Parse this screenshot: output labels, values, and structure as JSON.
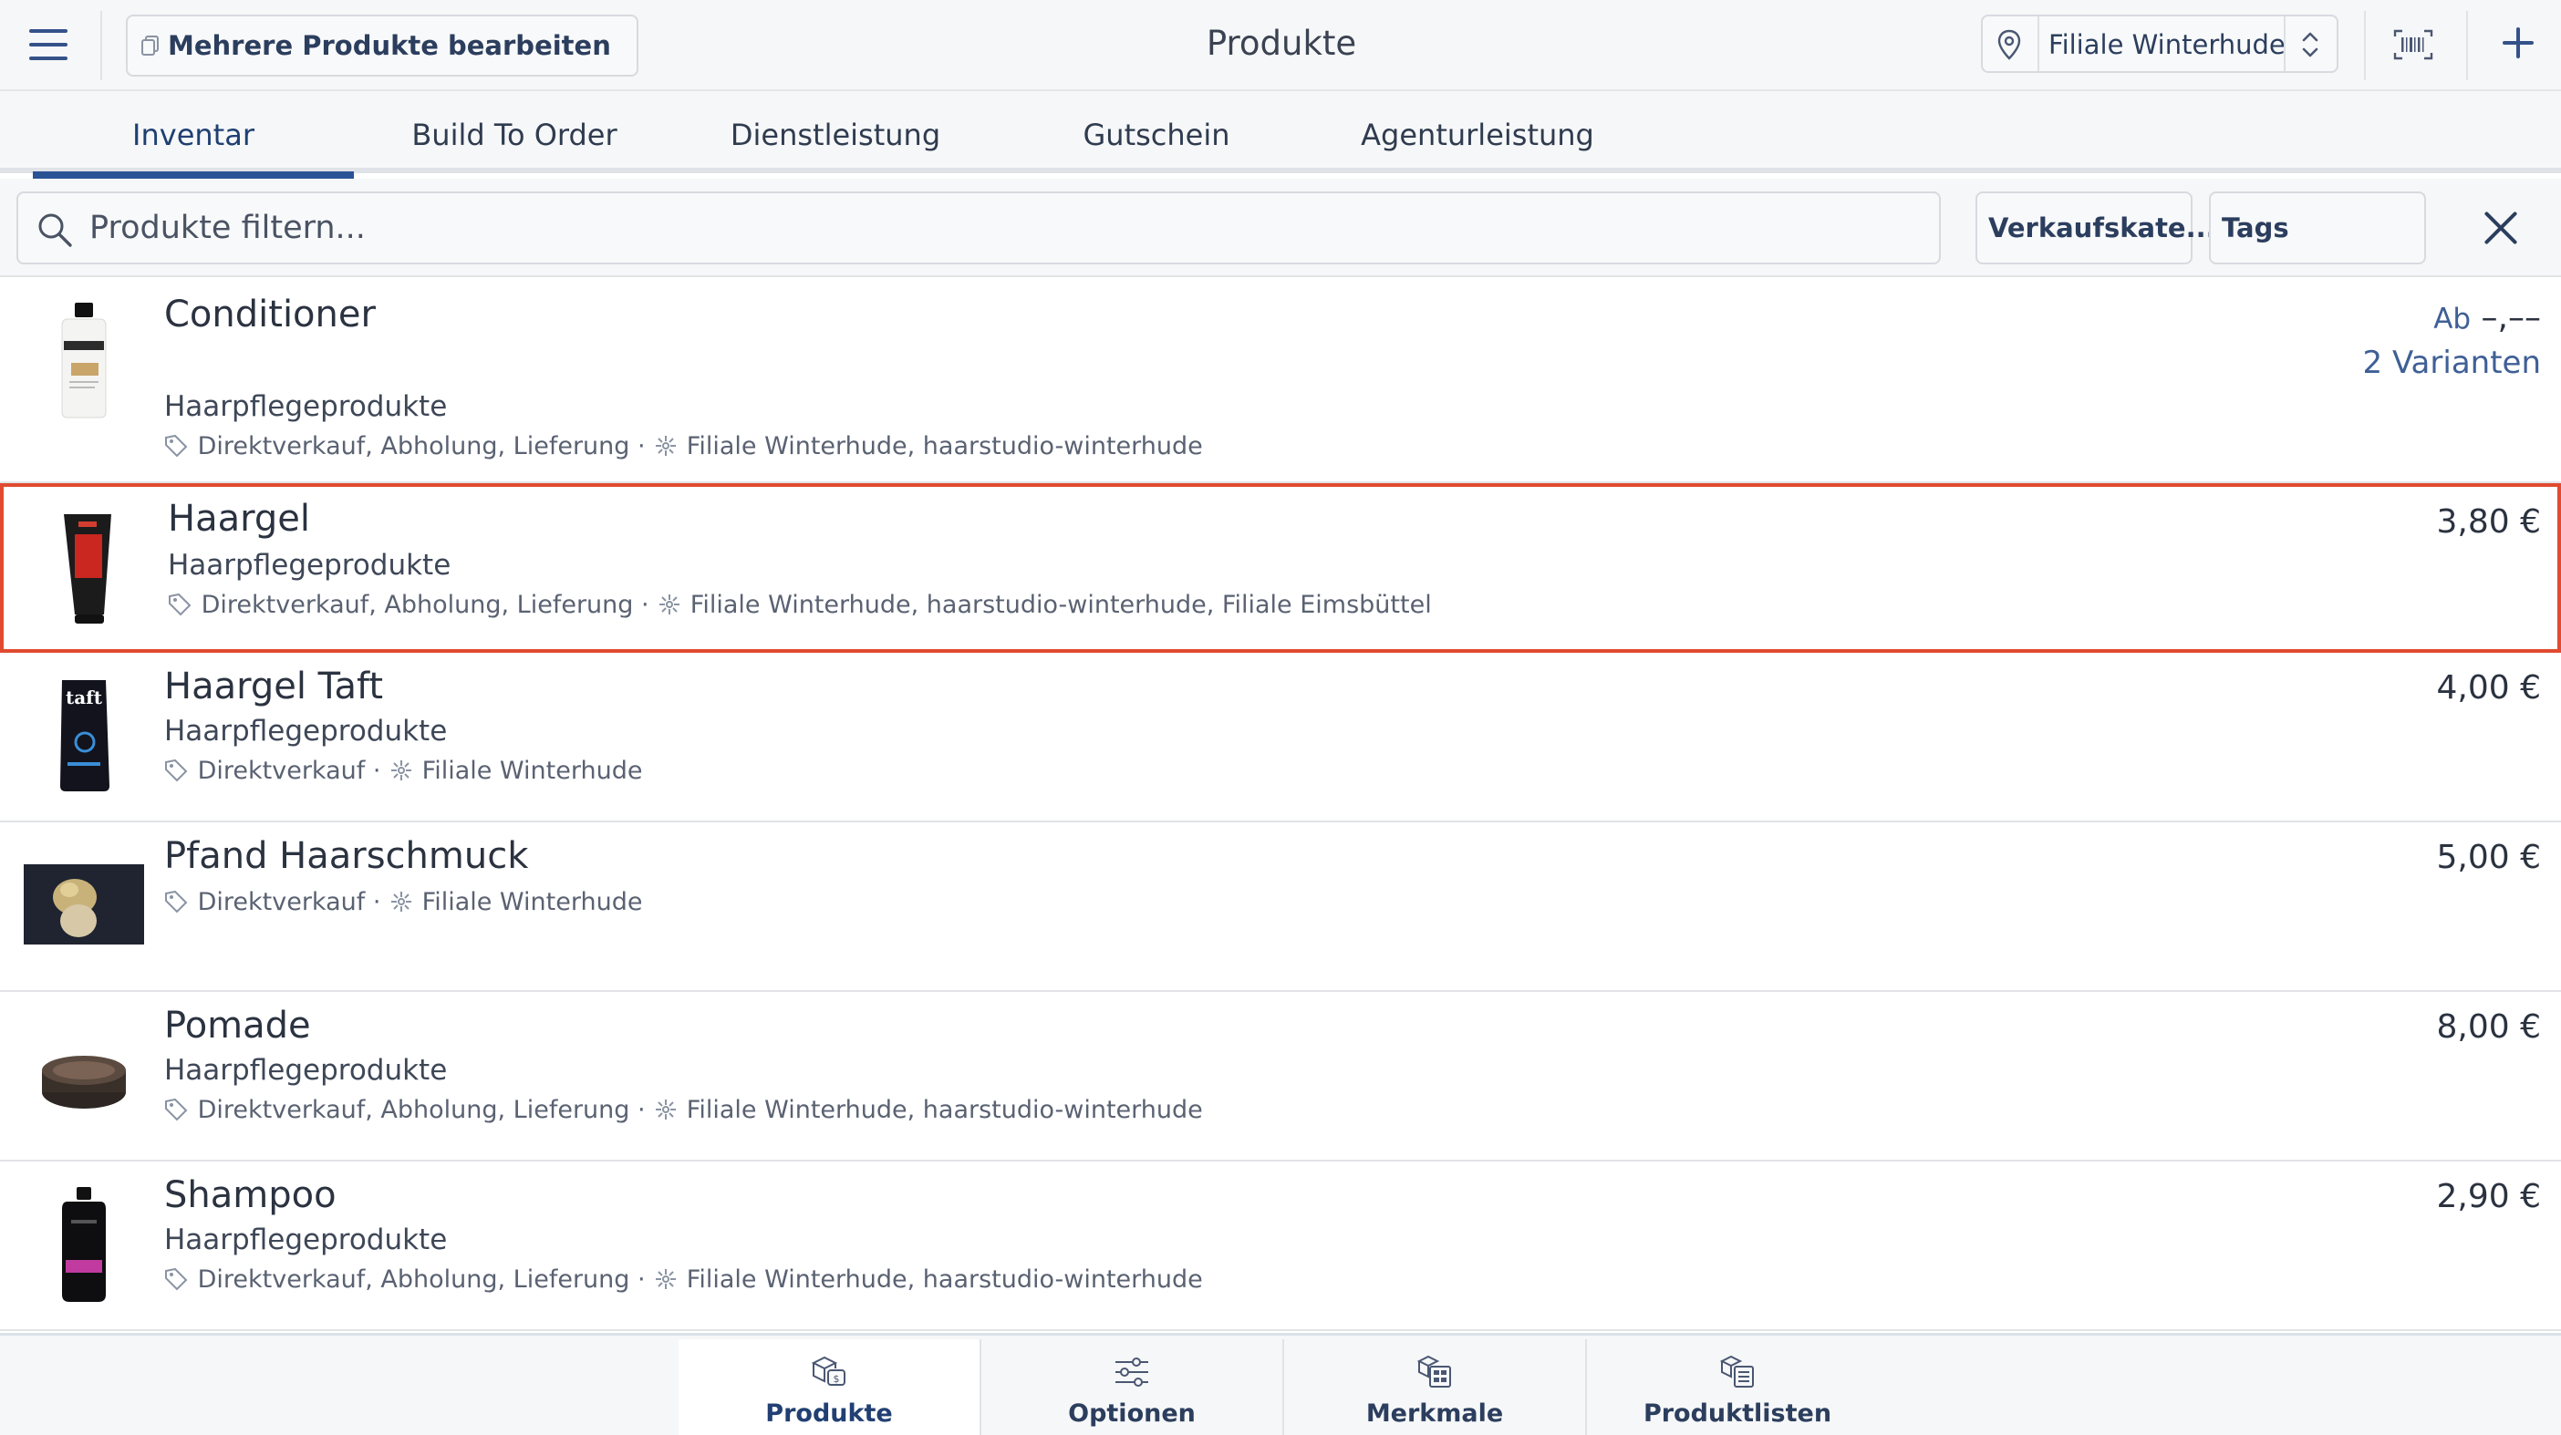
{
  "header": {
    "multi_edit_label": "Mehrere Produkte bearbeiten",
    "title": "Produkte",
    "store": "Filiale Winterhude",
    "icons": [
      "menu-icon",
      "copy-icon",
      "location-pin-icon",
      "updown-chevron-icon",
      "barcode-icon",
      "plus-icon"
    ]
  },
  "tabs": [
    {
      "label": "Inventar",
      "active": true
    },
    {
      "label": "Build To Order",
      "active": false
    },
    {
      "label": "Dienstleistung",
      "active": false
    },
    {
      "label": "Gutschein",
      "active": false
    },
    {
      "label": "Agenturleistung",
      "active": false
    }
  ],
  "filter": {
    "placeholder": "Produkte filtern...",
    "sales_category": "Verkaufskate...",
    "tags": "Tags"
  },
  "products": [
    {
      "name": "Conditioner",
      "category": "Haarpflegeprodukte",
      "channels": "Direktverkauf, Abholung, Lieferung",
      "stores": "Filiale Winterhude, haarstudio-winterhude",
      "price_prefix": "Ab",
      "price": "–,––",
      "variants": "2 Varianten",
      "selected": false
    },
    {
      "name": "Haargel",
      "category": "Haarpflegeprodukte",
      "channels": "Direktverkauf, Abholung, Lieferung",
      "stores": "Filiale Winterhude, haarstudio-winterhude, Filiale Eimsbüttel",
      "price": "3,80 €",
      "selected": true
    },
    {
      "name": "Haargel Taft",
      "category": "Haarpflegeprodukte",
      "channels": "Direktverkauf",
      "stores": "Filiale Winterhude",
      "price": "4,00 €",
      "selected": false
    },
    {
      "name": "Pfand Haarschmuck",
      "category": "",
      "channels": "Direktverkauf",
      "stores": "Filiale Winterhude",
      "price": "5,00 €",
      "selected": false
    },
    {
      "name": "Pomade",
      "category": "Haarpflegeprodukte",
      "channels": "Direktverkauf, Abholung, Lieferung",
      "stores": "Filiale Winterhude, haarstudio-winterhude",
      "price": "8,00 €",
      "selected": false
    },
    {
      "name": "Shampoo",
      "category": "Haarpflegeprodukte",
      "channels": "Direktverkauf, Abholung, Lieferung",
      "stores": "Filiale Winterhude, haarstudio-winterhude",
      "price": "2,90 €",
      "selected": false
    }
  ],
  "meta_separator": "·",
  "bottom_nav": [
    {
      "label": "Produkte",
      "icon": "products-icon",
      "active": true
    },
    {
      "label": "Optionen",
      "icon": "sliders-icon",
      "active": false
    },
    {
      "label": "Merkmale",
      "icon": "attributes-icon",
      "active": false
    },
    {
      "label": "Produktlisten",
      "icon": "product-lists-icon",
      "active": false
    }
  ],
  "colors": {
    "accent": "#2a5396",
    "selection": "#e04a2f",
    "text": "#2b3240",
    "background": "#f6f7f8"
  }
}
